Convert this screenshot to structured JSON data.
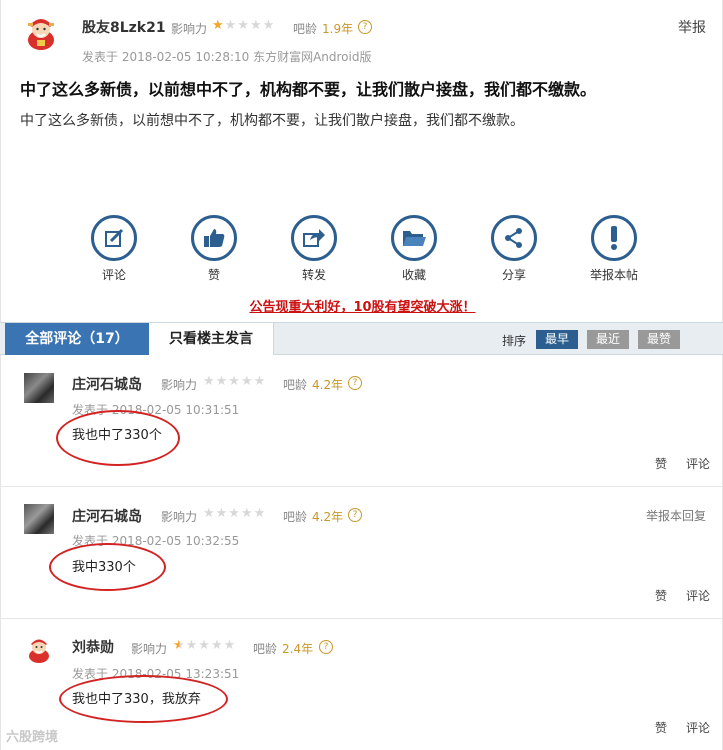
{
  "post": {
    "username": "股友8Lzk21",
    "influence_label": "影响力",
    "influence_stars": 1,
    "age_label": "吧龄",
    "age_value": "1.9年",
    "help_glyph": "?",
    "posted_at": "发表于 2018-02-05 10:28:10 东方财富网Android版",
    "report": "举报",
    "title": "中了这么多新债，以前想中不了，机构都不要，让我们散户接盘，我们都不缴款。",
    "body": "中了这么多新债，以前想中不了，机构都不要，让我们散户接盘，我们都不缴款。"
  },
  "actions": [
    {
      "label": "评论",
      "icon": "edit-icon"
    },
    {
      "label": "赞",
      "icon": "thumbs-up-icon"
    },
    {
      "label": "转发",
      "icon": "share-forward-icon"
    },
    {
      "label": "收藏",
      "icon": "folder-icon"
    },
    {
      "label": "分享",
      "icon": "share-icon"
    },
    {
      "label": "举报本帖",
      "icon": "exclamation-icon"
    }
  ],
  "promo": "公告现重大利好，10股有望突破大涨！",
  "tabs": {
    "all_comments": "全部评论（17）",
    "owner_only": "只看楼主发言",
    "sort_label": "排序",
    "sort_options": [
      "最早",
      "最近",
      "最赞"
    ],
    "sort_selected": "最早"
  },
  "comments": [
    {
      "username": "庄河石城岛",
      "influence_label": "影响力",
      "influence_stars": 0,
      "age_label": "吧龄",
      "age_value": "4.2年",
      "posted_at": "发表于 2018-02-05 10:31:51",
      "text": "我也中了330个",
      "like": "赞",
      "reply": "评论",
      "report": ""
    },
    {
      "username": "庄河石城岛",
      "influence_label": "影响力",
      "influence_stars": 0,
      "age_label": "吧龄",
      "age_value": "4.2年",
      "posted_at": "发表于 2018-02-05 10:32:55",
      "text": "我中330个",
      "like": "赞",
      "reply": "评论",
      "report": "举报本回复"
    },
    {
      "username": "刘恭勋",
      "influence_label": "影响力",
      "influence_stars": 0.5,
      "age_label": "吧龄",
      "age_value": "2.4年",
      "posted_at": "发表于 2018-02-05 13:23:51",
      "text": "我也中了330，我放弃",
      "like": "赞",
      "reply": "评论",
      "report": ""
    }
  ],
  "watermark": "六股跨境",
  "colors": {
    "accent": "#2c5f8f",
    "tab_active": "#3a74b3",
    "promo": "#cc1111",
    "annotation": "#d32222",
    "star": "#f6a623"
  }
}
